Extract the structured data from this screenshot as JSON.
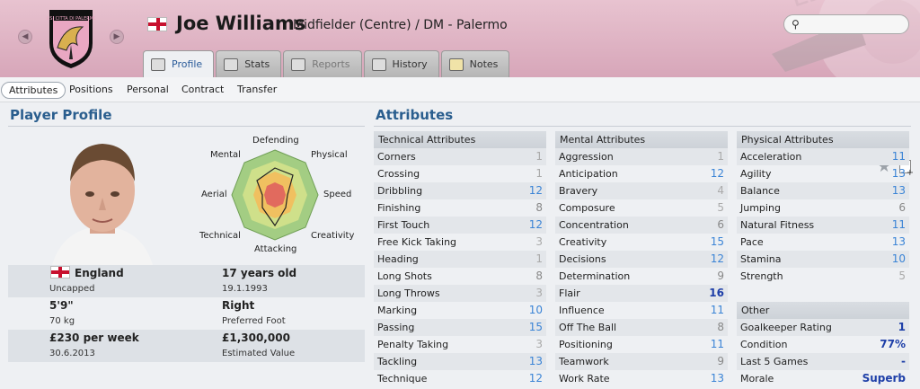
{
  "header": {
    "player_name": "Joe Williams",
    "position_club": "Midfielder (Centre) / DM - Palermo",
    "prev_icon": "chevron-left-icon",
    "next_icon": "chevron-right-icon",
    "search_icon": "search-icon",
    "search_placeholder": ""
  },
  "tabs": [
    {
      "label": "Profile",
      "icon": "profile-icon",
      "active": true
    },
    {
      "label": "Stats",
      "icon": "stats-icon"
    },
    {
      "label": "Reports",
      "icon": "reports-icon",
      "disabled": true
    },
    {
      "label": "History",
      "icon": "history-icon"
    },
    {
      "label": "Notes",
      "icon": "notes-icon"
    }
  ],
  "subnav": [
    "Attributes",
    "Positions",
    "Personal",
    "Contract",
    "Transfer"
  ],
  "profile": {
    "heading": "Player Profile",
    "radar_labels": {
      "top": "Defending",
      "top_left": "Mental",
      "top_right": "Physical",
      "left": "Aerial",
      "right": "Speed",
      "bottom_left": "Technical",
      "bottom": "Attacking",
      "bottom_right": "Creativity"
    },
    "nationality": "England",
    "caps": "Uncapped",
    "age": "17 years old",
    "dob": "19.1.1993",
    "height": "5'9\"",
    "weight": "70 kg",
    "foot": "Right",
    "foot_label": "Preferred Foot",
    "wage": "£230 per week",
    "contract_end": "30.6.2013",
    "value": "£1,300,000",
    "value_label": "Estimated Value"
  },
  "attributes": {
    "heading": "Attributes",
    "technical_title": "Technical Attributes",
    "technical": [
      [
        "Corners",
        "1"
      ],
      [
        "Crossing",
        "1"
      ],
      [
        "Dribbling",
        "12"
      ],
      [
        "Finishing",
        "8"
      ],
      [
        "First Touch",
        "12"
      ],
      [
        "Free Kick Taking",
        "3"
      ],
      [
        "Heading",
        "1"
      ],
      [
        "Long Shots",
        "8"
      ],
      [
        "Long Throws",
        "3"
      ],
      [
        "Marking",
        "10"
      ],
      [
        "Passing",
        "15"
      ],
      [
        "Penalty Taking",
        "3"
      ],
      [
        "Tackling",
        "13"
      ],
      [
        "Technique",
        "12"
      ]
    ],
    "mental_title": "Mental Attributes",
    "mental": [
      [
        "Aggression",
        "1"
      ],
      [
        "Anticipation",
        "12"
      ],
      [
        "Bravery",
        "4"
      ],
      [
        "Composure",
        "5"
      ],
      [
        "Concentration",
        "6"
      ],
      [
        "Creativity",
        "15"
      ],
      [
        "Decisions",
        "12"
      ],
      [
        "Determination",
        "9"
      ],
      [
        "Flair",
        "16"
      ],
      [
        "Influence",
        "11"
      ],
      [
        "Off The Ball",
        "8"
      ],
      [
        "Positioning",
        "11"
      ],
      [
        "Teamwork",
        "9"
      ],
      [
        "Work Rate",
        "13"
      ]
    ],
    "physical_title": "Physical Attributes",
    "physical": [
      [
        "Acceleration",
        "11"
      ],
      [
        "Agility",
        "13"
      ],
      [
        "Balance",
        "13"
      ],
      [
        "Jumping",
        "6"
      ],
      [
        "Natural Fitness",
        "11"
      ],
      [
        "Pace",
        "13"
      ],
      [
        "Stamina",
        "10"
      ],
      [
        "Strength",
        "5"
      ]
    ],
    "other_title": "Other",
    "other": [
      [
        "Goalkeeper Rating",
        "1"
      ],
      [
        "Condition",
        "77%"
      ],
      [
        "Last 5 Games",
        "-"
      ],
      [
        "Morale",
        "Superb"
      ]
    ]
  },
  "colors": {
    "header": "#e0b5c5",
    "accent_blue": "#2a5e8e",
    "value_blue": "#3b84d6",
    "flair_blue": "#1e3fa8"
  }
}
